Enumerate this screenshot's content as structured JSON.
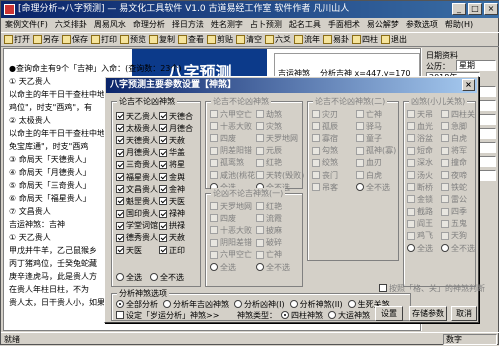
{
  "window": {
    "title": "[命理分析→八字预测] — 易文化工具软件  V1.0    古道易经工作室    软件作者  凡川山人",
    "min": "_",
    "max": "□",
    "close": "×"
  },
  "menu": [
    "案例文件(F)",
    "六爻排卦",
    "周易风水",
    "命理分析",
    "择日方法",
    "姓名测字",
    "占卜预测",
    "起名工具",
    "手面相术",
    "易公解梦",
    "参数选项",
    "帮助(H)"
  ],
  "toolbar": [
    "打开",
    "另存",
    "保存",
    "打印",
    "预览",
    "复制",
    "查看",
    "剪贴",
    "清空",
    "六爻",
    "流年",
    "易卦",
    "四柱",
    "退出"
  ],
  "content": {
    "banner": "八字预测",
    "info_title": "吉运神煞",
    "info_line": "分析吉神  x=447,y=170",
    "lines": [
      "●查询命主有9个「吉神」入命：(查询数：23个)",
      "① 天乙贵人",
      "   以命主的年干日干查柱中地支，主命中逢凶化吉，",
      "鸡位\"，时支\"酉鸡\"，有",
      "② 太极贵人",
      "   以命主的年干日干查柱中地",
      "免宝库通\"，时支\"酉鸡",
      "③ 命局天「天德贵人」",
      "④ 命局天「月德贵人」",
      "⑤ 命局天「三奇贵人」",
      "⑥ 命局天「福星贵人」",
      "⑦ 文昌贵人",
      "吉运神煞：吉神",
      "① 天乙贵人",
      "   甲戊并牛羊，乙己鼠猴乡",
      "   丙丁猪鸡位，壬癸兔蛇藏",
      "   庚辛逢虎马，此是贵人方",
      "   在贵人年柱日柱，不为",
      "   贵人太，日干贵人小，如果"
    ]
  },
  "right_panel": {
    "title": "日期资料",
    "gongli_label": "公历：",
    "gongli_value": "星期",
    "year_value": "2018年",
    "fields": [
      "",
      "",
      "",
      "",
      "",
      "",
      ""
    ]
  },
  "dialog": {
    "title": "八字预测主要参数设置【神煞】",
    "close": "×",
    "group1": {
      "title": "论吉不论凶神煞",
      "col1": [
        "天乙贵人",
        "太极贵人",
        "天德贵人",
        "月德贵人",
        "三奇贵人",
        "福星贵人",
        "文昌贵人",
        "魁罡贵人",
        "国印贵人",
        "学堂词馆",
        "德秀贵人",
        "天医"
      ],
      "col2": [
        "天德合",
        "月德合",
        "天赦",
        "华盖",
        "将星",
        "金舆",
        "金神",
        "天医",
        "禄神",
        "拱禄",
        "天赦",
        "正印"
      ],
      "select_all": "全选",
      "select_none": "全不选"
    },
    "group2": {
      "title": "论吉不论凶神煞",
      "col1": [
        "六甲空亡",
        "十恶大败",
        "四废",
        "阴差阳错",
        "孤鸾煞",
        "咸池(桃花)",
        "全选"
      ],
      "col2": [
        "劫煞",
        "灾煞",
        "天罗地网",
        "元辰",
        "红艳",
        "天转(毁败)",
        "全不选"
      ]
    },
    "group3": {
      "title": "论吉不论凶神煞(二)",
      "col1": [
        "灾刃",
        "孤辰",
        "寡宿",
        "勾煞",
        "绞煞",
        "丧门",
        "吊客"
      ],
      "col2": [
        "亡神",
        "驿马",
        "童子",
        "孤神(寡)",
        "血刃",
        "白虎",
        "全不选"
      ]
    },
    "group4": {
      "title": "论凶不论吉神煞(一)",
      "col1": [
        "天罗地网",
        "四废",
        "十恶大败",
        "阴阳差错",
        "六甲空亡",
        "全选"
      ],
      "col2": [
        "红艳",
        "流霞",
        "披麻",
        "破碎",
        "亡神",
        "全不选"
      ]
    },
    "group5": {
      "title": "吉神煞(二)",
      "col1": [
        "天乙贵人",
        "金舆",
        "魁罡",
        "学堂",
        "词馆",
        "天官贵人",
        "德秀",
        "天厨",
        "全选"
      ],
      "col2": [
        "拱禄",
        "红鸾",
        "天喜",
        "将星",
        "华盖",
        "天德合",
        "月德合",
        "灾煞",
        "全不选"
      ]
    },
    "group6": {
      "title": "凶煞(小儿关煞)",
      "col1": [
        "天吊",
        "血光",
        "浴盆",
        "短命",
        "深水",
        "汤火",
        "断桥",
        "金锁",
        "截路",
        "阎王",
        "鸡飞",
        "全选"
      ],
      "col2": [
        "四柱关",
        "急脚",
        "白虎",
        "将军",
        "撞命",
        "夜啼",
        "铁蛇",
        "雷公",
        "四季",
        "五鬼",
        "天狗",
        "全不选"
      ]
    },
    "options_title": "分析神煞选项",
    "radios": [
      "全部分析",
      "分析年吉凶神煞",
      "分析凶神(I)",
      "分析神煞(II)",
      "生死关煞"
    ],
    "radio_selected": 0,
    "option_a": "设定「岁运分析」神煞>>",
    "option_b_label": "神煞类型：",
    "option_b_radios": [
      "四柱神煞",
      "大运神煞"
    ],
    "option_b_selected": 0,
    "check_huaqi": "按照「格、关」的神煞判断",
    "btn_set": "设置",
    "btn_save": "存储参数",
    "btn_cancel": "取消"
  },
  "status": {
    "left": "就绪",
    "right": "数字"
  }
}
